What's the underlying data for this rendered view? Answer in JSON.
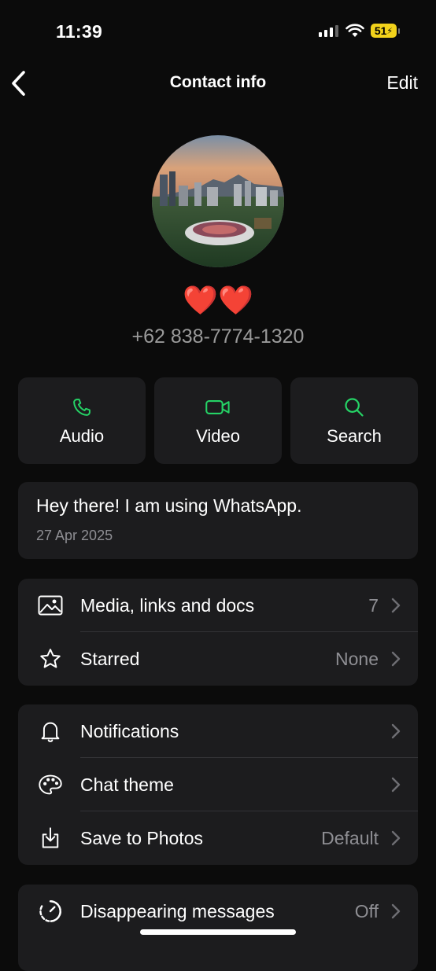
{
  "status_bar": {
    "time": "11:39",
    "battery": "51"
  },
  "nav": {
    "title": "Contact info",
    "edit": "Edit"
  },
  "contact": {
    "name_emoji": "❤️❤️",
    "phone": "+62 838-7774-1320"
  },
  "actions": [
    {
      "label": "Audio",
      "icon": "phone-icon"
    },
    {
      "label": "Video",
      "icon": "video-icon"
    },
    {
      "label": "Search",
      "icon": "search-icon"
    }
  ],
  "about": {
    "text": "Hey there! I am using WhatsApp.",
    "date": "27 Apr 2025"
  },
  "group1": [
    {
      "label": "Media, links and docs",
      "value": "7",
      "icon": "image-icon"
    },
    {
      "label": "Starred",
      "value": "None",
      "icon": "star-icon"
    }
  ],
  "group2": [
    {
      "label": "Notifications",
      "value": "",
      "icon": "bell-icon"
    },
    {
      "label": "Chat theme",
      "value": "",
      "icon": "palette-icon"
    },
    {
      "label": "Save to Photos",
      "value": "Default",
      "icon": "download-icon"
    }
  ],
  "group3": [
    {
      "label": "Disappearing messages",
      "value": "Off",
      "icon": "timer-icon"
    }
  ],
  "colors": {
    "accent": "#25D366",
    "card": "#1c1c1e",
    "background": "#0b0b0b",
    "muted": "#8e8e93"
  }
}
